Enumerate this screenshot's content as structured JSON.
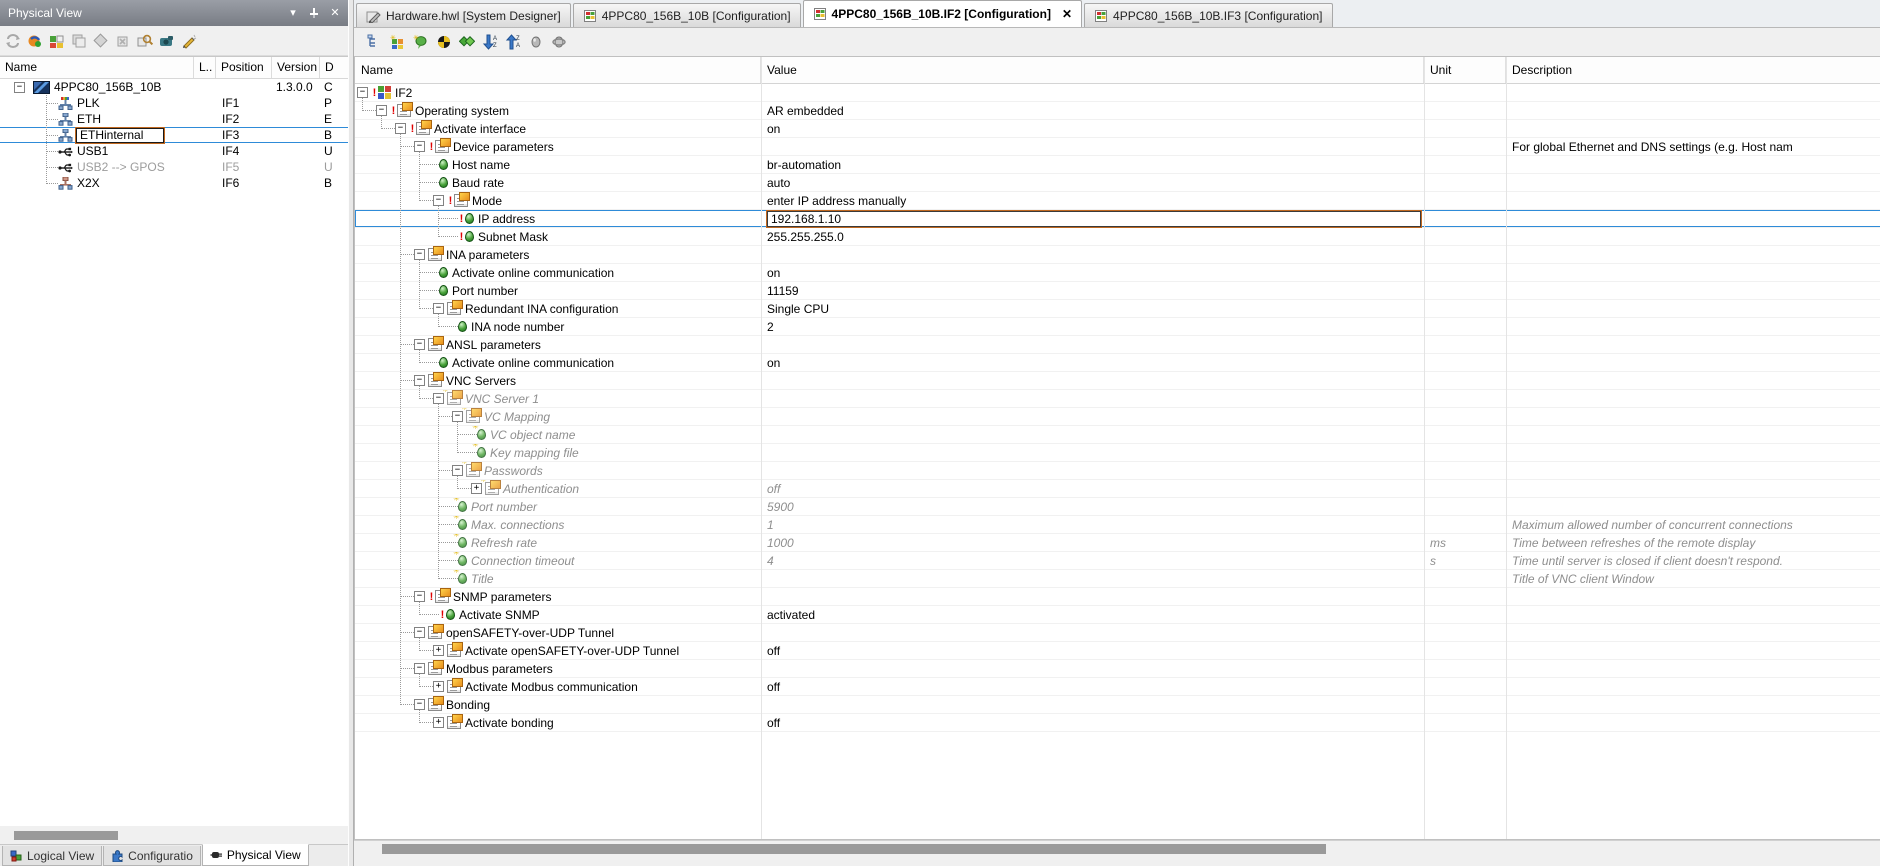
{
  "dock": {
    "title": "Physical View",
    "titlebar_icons": [
      "chevron-down-icon",
      "auto-hide-pin-icon",
      "close-icon"
    ],
    "toolbar_icons": [
      "refresh-icon",
      "upload-hardware-icon",
      "add-hardware-icon",
      "copy-hardware-icon",
      "replace-module-icon",
      "delete-module-icon",
      "find-hardware-icon",
      "camera-device-icon",
      "rename-icon"
    ],
    "columns": [
      "Name",
      "L..",
      "Position",
      "Version",
      "D"
    ],
    "rows": [
      {
        "name": "4PPC80_156B_10B",
        "icon": "panel",
        "root": true,
        "expander": "minus",
        "position": "",
        "version": "1.3.0.0",
        "d": "C"
      },
      {
        "name": "PLK",
        "icon": "plk",
        "position": "IF1",
        "d": "P"
      },
      {
        "name": "ETH",
        "icon": "eth",
        "position": "IF2",
        "d": "E"
      },
      {
        "name": "ETHinternal",
        "icon": "eth",
        "position": "IF3",
        "d": "B",
        "selected": true,
        "editing": true
      },
      {
        "name": "USB1",
        "icon": "usb",
        "position": "IF4",
        "d": "U"
      },
      {
        "name": "USB2 --> GPOS",
        "icon": "usb",
        "position": "IF5",
        "d": "U",
        "disabled": true
      },
      {
        "name": "X2X",
        "icon": "x2x",
        "position": "IF6",
        "d": "B"
      }
    ],
    "bottom_tabs": [
      {
        "label": "Logical View",
        "icon": "cubes-icon",
        "active": false
      },
      {
        "label": "Configuratio",
        "icon": "puzzle-icon",
        "active": false
      },
      {
        "label": "Physical View",
        "icon": "plug-icon",
        "active": true
      }
    ]
  },
  "editor": {
    "tabs": [
      {
        "label": "Hardware.hwl [System Designer]",
        "icon": "system-designer-icon",
        "active": false,
        "closable": false
      },
      {
        "label": "4PPC80_156B_10B [Configuration]",
        "icon": "configuration-icon",
        "active": false,
        "closable": false
      },
      {
        "label": "4PPC80_156B_10B.IF2 [Configuration]",
        "icon": "configuration-icon",
        "active": true,
        "closable": true,
        "close_glyph": "✕"
      },
      {
        "label": "4PPC80_156B_10B.IF3 [Configuration]",
        "icon": "configuration-icon",
        "active": false,
        "closable": false
      }
    ],
    "toolbar_icons": [
      "tree-view-icon",
      "hardware-catalog-icon",
      "balloon-help-icon",
      "locate-icon",
      "compare-icon",
      "sort-descending-icon",
      "sort-ascending-icon",
      "show-all-values-icon",
      "filter-values-icon"
    ],
    "columns": [
      "Name",
      "Value",
      "Unit",
      "Description"
    ],
    "rows": [
      {
        "lvl": 0,
        "t": "root",
        "exp": "minus",
        "alert": true,
        "nm": "IF2",
        "val": "",
        "unit": "",
        "desc": ""
      },
      {
        "lvl": 1,
        "t": "group",
        "exp": "minus",
        "alert": true,
        "nm": "Operating system",
        "val": "AR embedded",
        "unit": "",
        "desc": ""
      },
      {
        "lvl": 2,
        "t": "group",
        "exp": "minus",
        "alert": true,
        "nm": "Activate interface",
        "val": "on",
        "unit": "",
        "desc": ""
      },
      {
        "lvl": 3,
        "t": "group",
        "exp": "minus",
        "alert": true,
        "nm": "Device parameters",
        "val": "",
        "unit": "",
        "desc": "For global Ethernet and DNS settings (e.g. Host nam",
        "descNormal": true
      },
      {
        "lvl": 4,
        "t": "leaf",
        "nm": "Host name",
        "val": "br-automation",
        "unit": "",
        "desc": ""
      },
      {
        "lvl": 4,
        "t": "leaf",
        "nm": "Baud rate",
        "val": "auto",
        "unit": "",
        "desc": ""
      },
      {
        "lvl": 4,
        "t": "group",
        "exp": "minus",
        "alert": true,
        "nm": "Mode",
        "val": "enter IP address manually",
        "unit": "",
        "desc": ""
      },
      {
        "lvl": 5,
        "t": "leaf",
        "alert": true,
        "sel": true,
        "edit": true,
        "nm": "IP address",
        "val": "192.168.1.10",
        "unit": "",
        "desc": ""
      },
      {
        "lvl": 5,
        "t": "leaf",
        "alert": true,
        "nm": "Subnet Mask",
        "val": "255.255.255.0",
        "unit": "",
        "desc": ""
      },
      {
        "lvl": 3,
        "t": "group",
        "exp": "minus",
        "nm": "INA parameters",
        "val": "",
        "unit": "",
        "desc": ""
      },
      {
        "lvl": 4,
        "t": "leaf",
        "nm": "Activate online communication",
        "val": "on",
        "unit": "",
        "desc": ""
      },
      {
        "lvl": 4,
        "t": "leaf",
        "nm": "Port number",
        "val": "11159",
        "unit": "",
        "desc": ""
      },
      {
        "lvl": 4,
        "t": "group",
        "exp": "minus",
        "nm": "Redundant INA configuration",
        "val": "Single CPU",
        "unit": "",
        "desc": ""
      },
      {
        "lvl": 5,
        "t": "leaf",
        "nm": "INA node number",
        "val": "2",
        "unit": "",
        "desc": ""
      },
      {
        "lvl": 3,
        "t": "group",
        "exp": "minus",
        "nm": "ANSL parameters",
        "val": "",
        "unit": "",
        "desc": ""
      },
      {
        "lvl": 4,
        "t": "leaf",
        "nm": "Activate online communication",
        "val": "on",
        "unit": "",
        "desc": ""
      },
      {
        "lvl": 3,
        "t": "group",
        "exp": "minus",
        "nm": "VNC Servers",
        "val": "",
        "unit": "",
        "desc": ""
      },
      {
        "lvl": 4,
        "t": "group",
        "exp": "minus",
        "dis": true,
        "nm": "VNC Server 1",
        "val": "",
        "unit": "",
        "desc": ""
      },
      {
        "lvl": 5,
        "t": "group",
        "exp": "minus",
        "dis": true,
        "nm": "VC Mapping",
        "val": "",
        "unit": "",
        "desc": ""
      },
      {
        "lvl": 6,
        "t": "leaf",
        "dis": true,
        "nm": "VC object name",
        "val": "",
        "unit": "",
        "desc": ""
      },
      {
        "lvl": 6,
        "t": "leaf",
        "dis": true,
        "nm": "Key mapping file",
        "val": "",
        "unit": "",
        "desc": ""
      },
      {
        "lvl": 5,
        "t": "group",
        "exp": "minus",
        "dis": true,
        "nm": "Passwords",
        "val": "",
        "unit": "",
        "desc": ""
      },
      {
        "lvl": 6,
        "t": "group",
        "exp": "plus",
        "dis": true,
        "nm": "Authentication",
        "val": "off",
        "unit": "",
        "desc": ""
      },
      {
        "lvl": 5,
        "t": "leaf",
        "dis": true,
        "nm": "Port number",
        "val": "5900",
        "unit": "",
        "desc": ""
      },
      {
        "lvl": 5,
        "t": "leaf",
        "dis": true,
        "nm": "Max. connections",
        "val": "1",
        "unit": "",
        "desc": "Maximum allowed number of concurrent connections"
      },
      {
        "lvl": 5,
        "t": "leaf",
        "dis": true,
        "nm": "Refresh rate",
        "val": "1000",
        "unit": "ms",
        "desc": "Time between refreshes of the remote display"
      },
      {
        "lvl": 5,
        "t": "leaf",
        "dis": true,
        "nm": "Connection timeout",
        "val": "4",
        "unit": "s",
        "desc": "Time until server is closed if client doesn't respond."
      },
      {
        "lvl": 5,
        "t": "leaf",
        "dis": true,
        "nm": "Title",
        "val": "",
        "unit": "",
        "desc": "Title of VNC client Window"
      },
      {
        "lvl": 3,
        "t": "group",
        "exp": "minus",
        "alert": true,
        "nm": "SNMP parameters",
        "val": "",
        "unit": "",
        "desc": ""
      },
      {
        "lvl": 4,
        "t": "leaf",
        "alert": true,
        "nm": "Activate SNMP",
        "val": "activated",
        "unit": "",
        "desc": ""
      },
      {
        "lvl": 3,
        "t": "group",
        "exp": "minus",
        "nm": "openSAFETY-over-UDP Tunnel",
        "val": "",
        "unit": "",
        "desc": ""
      },
      {
        "lvl": 4,
        "t": "group",
        "exp": "plus",
        "nm": "Activate openSAFETY-over-UDP Tunnel",
        "val": "off",
        "unit": "",
        "desc": ""
      },
      {
        "lvl": 3,
        "t": "group",
        "exp": "minus",
        "nm": "Modbus parameters",
        "val": "",
        "unit": "",
        "desc": ""
      },
      {
        "lvl": 4,
        "t": "group",
        "exp": "plus",
        "nm": "Activate Modbus communication",
        "val": "off",
        "unit": "",
        "desc": ""
      },
      {
        "lvl": 3,
        "t": "group",
        "exp": "minus",
        "nm": "Bonding",
        "val": "",
        "unit": "",
        "desc": ""
      },
      {
        "lvl": 4,
        "t": "group",
        "exp": "plus",
        "nm": "Activate bonding",
        "val": "off",
        "unit": "",
        "desc": ""
      }
    ]
  },
  "colors": {
    "selection_blue": "#2e8bd8",
    "alert_red": "#e00000",
    "edit_outline_orange": "#c06820",
    "disabled_grey": "#8e8e8e"
  }
}
